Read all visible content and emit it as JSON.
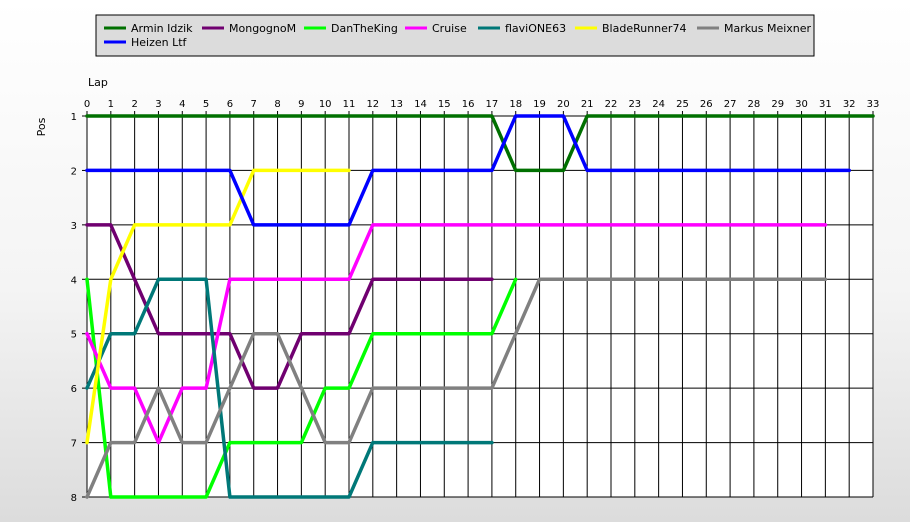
{
  "chart_data": {
    "type": "line",
    "xlabel": "Lap",
    "ylabel": "Pos",
    "xlim": [
      0,
      33
    ],
    "ylim": [
      1,
      8
    ],
    "x_ticks": [
      0,
      1,
      2,
      3,
      4,
      5,
      6,
      7,
      8,
      9,
      10,
      11,
      12,
      13,
      14,
      15,
      16,
      17,
      18,
      19,
      20,
      21,
      22,
      23,
      24,
      25,
      26,
      27,
      28,
      29,
      30,
      31,
      32,
      33
    ],
    "y_ticks": [
      1,
      2,
      3,
      4,
      5,
      6,
      7,
      8
    ],
    "y_inverted": true,
    "grid": true,
    "legend_position": "top",
    "series": [
      {
        "name": "Armin Idzik",
        "color": "#007000",
        "points": [
          [
            0,
            1
          ],
          [
            17,
            1
          ],
          [
            18,
            2
          ],
          [
            20,
            2
          ],
          [
            21,
            1
          ],
          [
            33,
            1
          ]
        ]
      },
      {
        "name": "MongognoM",
        "color": "#700070",
        "points": [
          [
            0,
            3
          ],
          [
            1,
            3
          ],
          [
            2,
            4
          ],
          [
            3,
            5
          ],
          [
            5,
            5
          ],
          [
            6,
            5
          ],
          [
            7,
            6
          ],
          [
            8,
            6
          ],
          [
            9,
            5
          ],
          [
            11,
            5
          ],
          [
            12,
            4
          ],
          [
            17,
            4
          ]
        ]
      },
      {
        "name": "DanTheKing",
        "color": "#00ff00",
        "points": [
          [
            0,
            4
          ],
          [
            1,
            8
          ],
          [
            5,
            8
          ],
          [
            6,
            7
          ],
          [
            9,
            7
          ],
          [
            10,
            6
          ],
          [
            11,
            6
          ],
          [
            12,
            5
          ],
          [
            17,
            5
          ],
          [
            18,
            4
          ]
        ]
      },
      {
        "name": "Cruise",
        "color": "#ff00ff",
        "points": [
          [
            0,
            5
          ],
          [
            1,
            6
          ],
          [
            2,
            6
          ],
          [
            3,
            7
          ],
          [
            4,
            6
          ],
          [
            5,
            6
          ],
          [
            6,
            4
          ],
          [
            11,
            4
          ],
          [
            12,
            3
          ],
          [
            31,
            3
          ]
        ]
      },
      {
        "name": "flaviONE63",
        "color": "#007878",
        "points": [
          [
            0,
            6
          ],
          [
            1,
            5
          ],
          [
            2,
            5
          ],
          [
            3,
            4
          ],
          [
            5,
            4
          ],
          [
            6,
            8
          ],
          [
            11,
            8
          ],
          [
            12,
            7
          ],
          [
            17,
            7
          ]
        ]
      },
      {
        "name": "BladeRunner74",
        "color": "#ffff00",
        "points": [
          [
            0,
            7
          ],
          [
            1,
            4
          ],
          [
            2,
            3
          ],
          [
            6,
            3
          ],
          [
            7,
            2
          ],
          [
            11,
            2
          ]
        ]
      },
      {
        "name": "Markus  Meixner",
        "color": "#808080",
        "points": [
          [
            0,
            8
          ],
          [
            1,
            7
          ],
          [
            2,
            7
          ],
          [
            3,
            6
          ],
          [
            4,
            7
          ],
          [
            5,
            7
          ],
          [
            6,
            6
          ],
          [
            7,
            5
          ],
          [
            8,
            5
          ],
          [
            9,
            6
          ],
          [
            10,
            7
          ],
          [
            11,
            7
          ],
          [
            12,
            6
          ],
          [
            17,
            6
          ],
          [
            18,
            5
          ],
          [
            19,
            4
          ],
          [
            31,
            4
          ]
        ]
      },
      {
        "name": "Heizen Ltf",
        "color": "#0000ff",
        "points": [
          [
            0,
            2
          ],
          [
            6,
            2
          ],
          [
            7,
            3
          ],
          [
            11,
            3
          ],
          [
            12,
            2
          ],
          [
            17,
            2
          ],
          [
            18,
            1
          ],
          [
            20,
            1
          ],
          [
            21,
            2
          ],
          [
            32,
            2
          ]
        ]
      }
    ]
  }
}
